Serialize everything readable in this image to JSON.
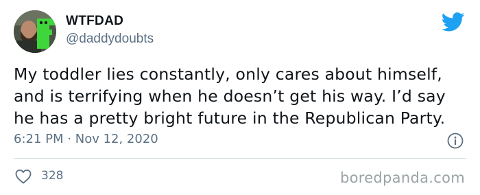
{
  "author": {
    "display_name": "WTFDAD",
    "handle": "@daddydoubts",
    "avatar_icon": "profile-photo"
  },
  "platform_icon": "twitter-bird-icon",
  "tweet": {
    "lines": [
      "My toddler lies constantly, only cares about himself,",
      "and is terrifying when he doesn’t get his way. I’d say",
      "he has a pretty bright future in the Republican Party."
    ],
    "time": "6:21 PM",
    "separator": "·",
    "date": "Nov 12, 2020"
  },
  "engagement": {
    "like_icon": "heart-icon",
    "likes": "328"
  },
  "info_icon": "info-icon",
  "watermark": "boredpanda.com",
  "colors": {
    "twitter_blue": "#1da1f2",
    "secondary_text": "#5b7083",
    "primary_text": "#0f1419",
    "divider": "#cfd9de",
    "watermark": "#9aa3a6"
  }
}
